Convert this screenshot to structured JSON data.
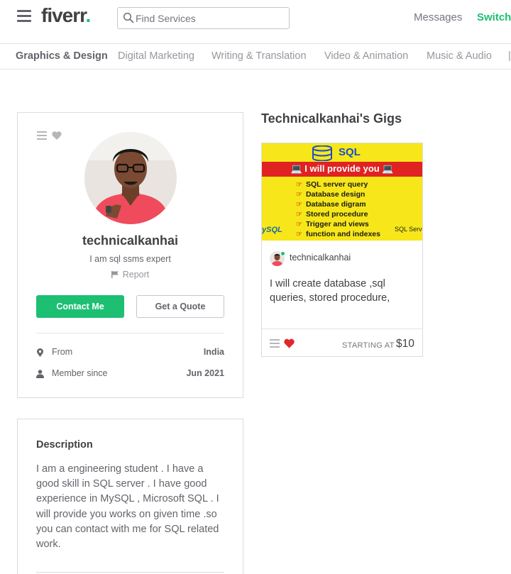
{
  "header": {
    "logo_text": "fiverr",
    "logo_dot": ".",
    "search_placeholder": "Find Services",
    "messages": "Messages",
    "switch": "Switch"
  },
  "categories": [
    {
      "label": "Graphics & Design",
      "active": true
    },
    {
      "label": "Digital Marketing",
      "active": false
    },
    {
      "label": "Writing & Translation",
      "active": false
    },
    {
      "label": "Video & Animation",
      "active": false
    },
    {
      "label": "Music & Audio",
      "active": false
    }
  ],
  "profile": {
    "username": "technicalkanhai",
    "tagline": "I am sql ssms expert",
    "report": "Report",
    "contact_button": "Contact Me",
    "quote_button": "Get a Quote",
    "stats": [
      {
        "icon": "location-pin-icon",
        "label": "From",
        "value": "India"
      },
      {
        "icon": "user-icon",
        "label": "Member since",
        "value": "Jun 2021"
      }
    ]
  },
  "description": {
    "title": "Description",
    "text": "I am a engineering student . I have a good skill in SQL server . I have good experience in MySQL , Microsoft SQL . I will provide you works on given time .so you can contact with me for SQL related work."
  },
  "gigs": {
    "title": "Technicalkanhai's Gigs",
    "items": [
      {
        "image": {
          "heading": "SQL",
          "banner": "💻 I will provide you 💻",
          "bullets": [
            "SQL server query",
            "Database design",
            "Database digram",
            "Stored procedure",
            "Trigger and views",
            "function and indexes"
          ],
          "left_logo": "ySQL",
          "right_logo": "SQL Serv"
        },
        "seller": "technicalkanhai",
        "description": "I will create database ,sql queries, stored procedure, triggers and views",
        "starting_label": "STARTING AT",
        "price": "$10"
      }
    ]
  },
  "colors": {
    "brand_green": "#1dbf73",
    "heart_red": "#e0272a",
    "text_dark": "#404145"
  }
}
